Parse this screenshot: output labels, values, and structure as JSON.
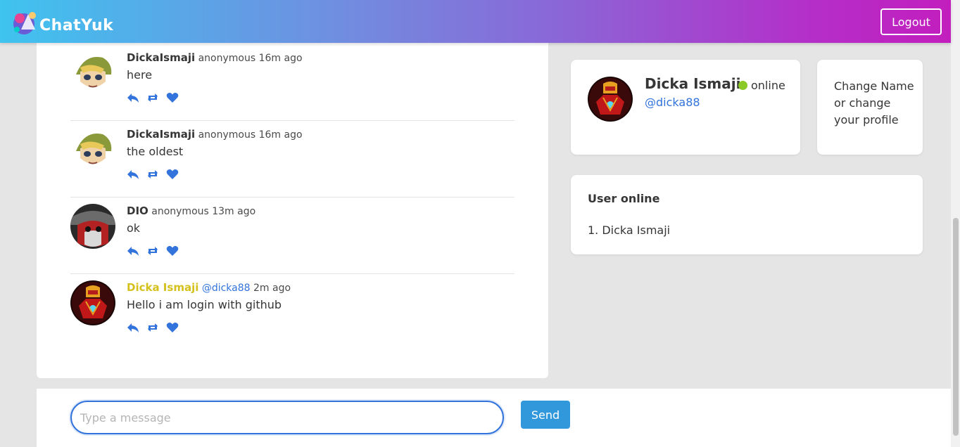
{
  "app": {
    "title": "ChatYuk",
    "logout_label": "Logout"
  },
  "messages": [
    {
      "name": "DickaIsmaji",
      "meta": "anonymous 16m ago",
      "text": "here",
      "avatar": "link-avatar"
    },
    {
      "name": "DickaIsmaji",
      "meta": "anonymous 16m ago",
      "text": "the oldest",
      "avatar": "link-avatar"
    },
    {
      "name": "DIO",
      "meta": "anonymous 13m ago",
      "text": "ok",
      "avatar": "dio-avatar"
    },
    {
      "name": "Dicka Ismaji",
      "handle": "@dicka88",
      "meta": "2m ago",
      "text": "Hello i am login with github",
      "avatar": "ironman-avatar"
    }
  ],
  "profile": {
    "name": "Dicka Ismaji",
    "handle": "@dicka88",
    "status": "online"
  },
  "change_profile": {
    "label": "Change Name or change your profile"
  },
  "online_users": {
    "title": "User online",
    "items": [
      "1. Dicka Ismaji"
    ]
  },
  "composer": {
    "placeholder": "Type a message",
    "value": "",
    "send_label": "Send"
  },
  "colors": {
    "accent": "#3273dc",
    "send": "#3298dc",
    "self_name": "#d4c11c",
    "online": "#8ac926"
  }
}
